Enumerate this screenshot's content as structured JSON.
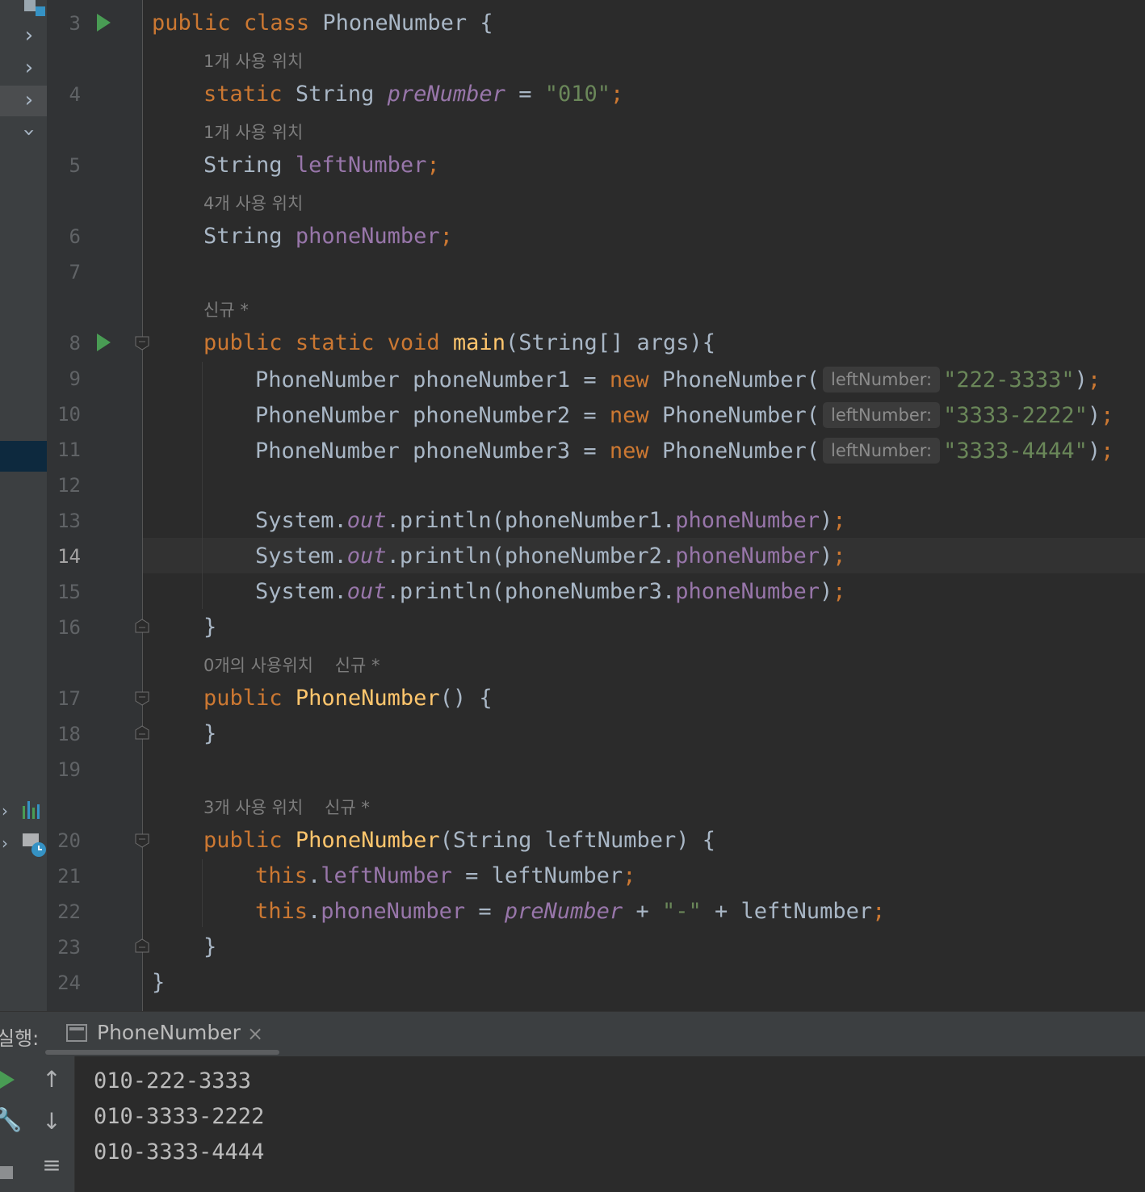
{
  "editor": {
    "line_numbers": [
      "3",
      "4",
      "5",
      "6",
      "7",
      "8",
      "9",
      "10",
      "11",
      "12",
      "13",
      "14",
      "15",
      "16",
      "17",
      "18",
      "19",
      "20",
      "21",
      "22",
      "23",
      "24"
    ],
    "current_line": "14",
    "hints": {
      "h4": "1개 사용 위치",
      "h5": "1개 사용 위치",
      "h6": "4개 사용 위치",
      "h8": "신규 *",
      "h17a": "0개의 사용위치",
      "h17b": "신규 *",
      "h20a": "3개 사용 위치",
      "h20b": "신규 *"
    },
    "inlay_label": "leftNumber:",
    "lines": {
      "l3": {
        "kw1": "public",
        "kw2": "class",
        "name": "PhoneNumber",
        "rest": " {"
      },
      "l4": {
        "kw": "static",
        "type": "String",
        "field": "preNumber",
        "eq": " = ",
        "str": "\"010\"",
        "semi": ";"
      },
      "l5": {
        "type": "String",
        "field": "leftNumber",
        "semi": ";"
      },
      "l6": {
        "type": "String",
        "field": "phoneNumber",
        "semi": ";"
      },
      "l8": {
        "kw1": "public",
        "kw2": "static",
        "kw3": "void",
        "fn": "main",
        "rest": "(String[] args){"
      },
      "l9": {
        "pre": "PhoneNumber phoneNumber1 = ",
        "kw": "new",
        "call": " PhoneNumber(",
        "str": "\"222-3333\"",
        "close": ")",
        "semi": ";"
      },
      "l10": {
        "pre": "PhoneNumber phoneNumber2 = ",
        "kw": "new",
        "call": " PhoneNumber(",
        "str": "\"3333-2222\"",
        "close": ")",
        "semi": ";"
      },
      "l11": {
        "pre": "PhoneNumber phoneNumber3 = ",
        "kw": "new",
        "call": " PhoneNumber(",
        "str": "\"3333-4444\"",
        "close": ")",
        "semi": ";"
      },
      "l13": {
        "a": "System.",
        "out": "out",
        "b": ".println(phoneNumber1.",
        "field": "phoneNumber",
        "close": ")",
        "semi": ";"
      },
      "l14": {
        "a": "System.",
        "out": "out",
        "b": ".println(phoneNumber2.",
        "field": "phoneNumber",
        "close": ")",
        "semi": ";"
      },
      "l15": {
        "a": "System.",
        "out": "out",
        "b": ".println(phoneNumber3.",
        "field": "phoneNumber",
        "close": ")",
        "semi": ";"
      },
      "l16": "}",
      "l17": {
        "kw": "public",
        "fn": "PhoneNumber",
        "rest": "() {"
      },
      "l18": "}",
      "l20": {
        "kw": "public",
        "fn": "PhoneNumber",
        "rest": "(String leftNumber) {"
      },
      "l21": {
        "kw": "this",
        "dot": ".",
        "field": "leftNumber",
        "rest": " = leftNumber",
        "semi": ";"
      },
      "l22": {
        "kw": "this",
        "dot": ".",
        "field": "phoneNumber",
        "eq": " = ",
        "sf": "preNumber",
        "plus1": " + ",
        "str": "\"-\"",
        "rest": " + leftNumber",
        "semi": ";"
      },
      "l23": "}",
      "l24": "}"
    }
  },
  "run_panel": {
    "label": "실행:",
    "tab_title": "PhoneNumber",
    "close_icon": "×",
    "output": [
      "010-222-3333",
      "010-3333-2222",
      "010-3333-4444"
    ]
  },
  "colors": {
    "keyword": "#cc7832",
    "field": "#9876aa",
    "string": "#6a8759",
    "function": "#ffc66d",
    "text": "#a9b7c6",
    "background": "#2b2b2b"
  }
}
